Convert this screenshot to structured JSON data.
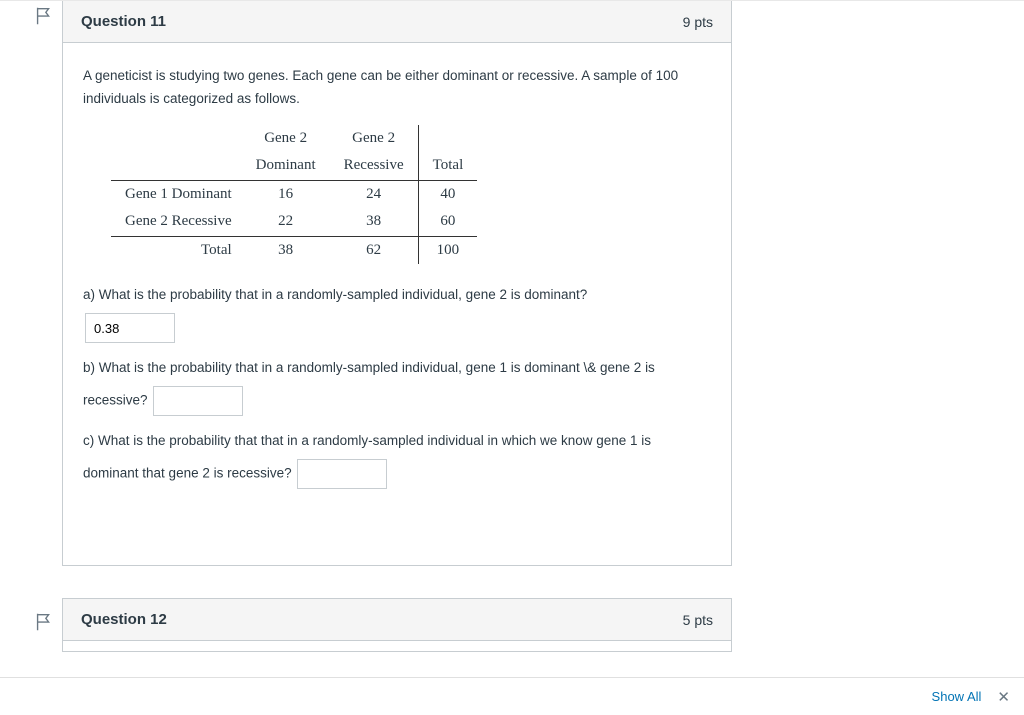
{
  "q11": {
    "title": "Question 11",
    "pts": "9 pts",
    "intro": "A geneticist is studying two genes. Each gene can be either dominant or recessive. A sample of 100 individuals is categorized as follows.",
    "table": {
      "col_hdr_top": [
        "",
        "Gene 2",
        "Gene 2",
        ""
      ],
      "col_hdr_bot": [
        "",
        "Dominant",
        "Recessive",
        "Total"
      ],
      "rows": [
        {
          "label": "Gene 1 Dominant",
          "c1": "16",
          "c2": "24",
          "c3": "40"
        },
        {
          "label": "Gene 2 Recessive",
          "c1": "22",
          "c2": "38",
          "c3": "60"
        },
        {
          "label": "Total",
          "c1": "38",
          "c2": "62",
          "c3": "100"
        }
      ]
    },
    "part_a": "a) What is the probability that in a randomly-sampled individual, gene 2 is dominant?",
    "ans_a": "0.38",
    "part_b_pre": "b) What is the probability that in a randomly-sampled individual, gene 1 is dominant \\& gene 2 is",
    "part_b_post": "recessive?",
    "ans_b": "",
    "part_c_pre": "c) What is the probability that that in a randomly-sampled individual in which we know gene 1 is",
    "part_c_post": "dominant that gene 2 is recessive?",
    "ans_c": ""
  },
  "q12": {
    "title": "Question 12",
    "pts": "5 pts"
  },
  "footer": {
    "show_all": "Show All"
  }
}
